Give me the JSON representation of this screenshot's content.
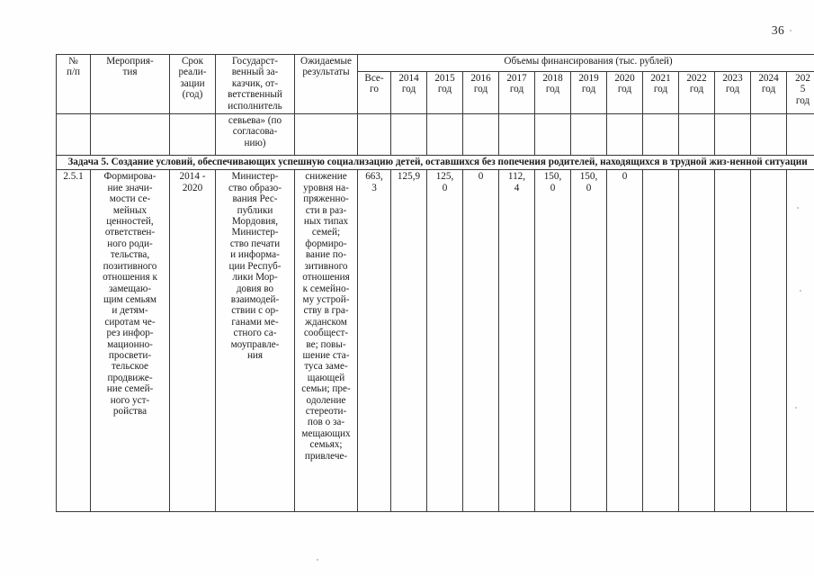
{
  "document": {
    "page_number": "36"
  },
  "table": {
    "headers": {
      "row_number": "№\nп/п",
      "event": "Мероприя-\nтия",
      "term": "Срок\nреали-\nзации\n(год)",
      "customer": "Государст-\nвенный за-\nказчик, от-\nветственный\nисполнитель",
      "results": "Ожидаемые\nрезультаты",
      "financing_group": "Объемы финансирования (тыс. рублей)",
      "total": "Все-\nго",
      "years": [
        "2014\nгод",
        "2015\nгод",
        "2016\nгод",
        "2017\nгод",
        "2018\nгод",
        "2019\nгод",
        "2020\nгод",
        "2021\nгод",
        "2022\nгод",
        "2023\nгод",
        "2024\nгод",
        "202\n5\nгод"
      ]
    },
    "header_continuation": {
      "row_number": "",
      "event": "",
      "term": "",
      "customer": "севьева» (по\nсогласова-\nнию)",
      "results": "",
      "total": "",
      "years": [
        "",
        "",
        "",
        "",
        "",
        "",
        "",
        "",
        "",
        "",
        "",
        ""
      ]
    },
    "task_row": {
      "label": "Задача 5. Создание условий, обеспечивающих успешную социализацию детей, оставшихся без попечения родителей, находящихся в трудной жиз-ненной ситуации"
    },
    "rows": [
      {
        "row_number": "2.5.1",
        "event": "Формирова-\nние значи-\nмости се-\nмейных\nценностей,\nответствен-\nного роди-\nтельства,\nпозитивного\nотношения к\nзамещаю-\nщим семьям\nи детям-\nсиротам че-\nрез инфор-\nмационно-\nпросвети-\nтельское\nпродвиже-\nние семей-\nного уст-\nройства",
        "term": "2014 -\n2020",
        "customer": "Министер-\nство образо-\nвания Рес-\nпублики\nМордовия,\nМинистер-\nство печати\nи информа-\nции Респуб-\nлики Мор-\nдовия во\nвзаимодей-\nствии с ор-\nганами ме-\nстного са-\nмоуправле-\nния",
        "results": "снижение\nуровня на-\nпряженно-\nсти в раз-\nных типах\nсемей;\nформиро-\nвание по-\nзитивного\nотношения\nк семейно-\nму устрой-\nству в гра-\nжданском\nсообщест-\nве; повы-\nшение ста-\nтуса заме-\nщающей\nсемьи; пре-\nодоление\nстереоти-\nпов о за-\nмещающих\nсемьях;\nпривлече-",
        "total": "663,\n3",
        "values": [
          "125,9",
          "125,\n0",
          "0",
          "112,\n4",
          "150,\n0",
          "150,\n0",
          "0",
          "",
          "",
          "",
          "",
          ""
        ]
      }
    ]
  }
}
